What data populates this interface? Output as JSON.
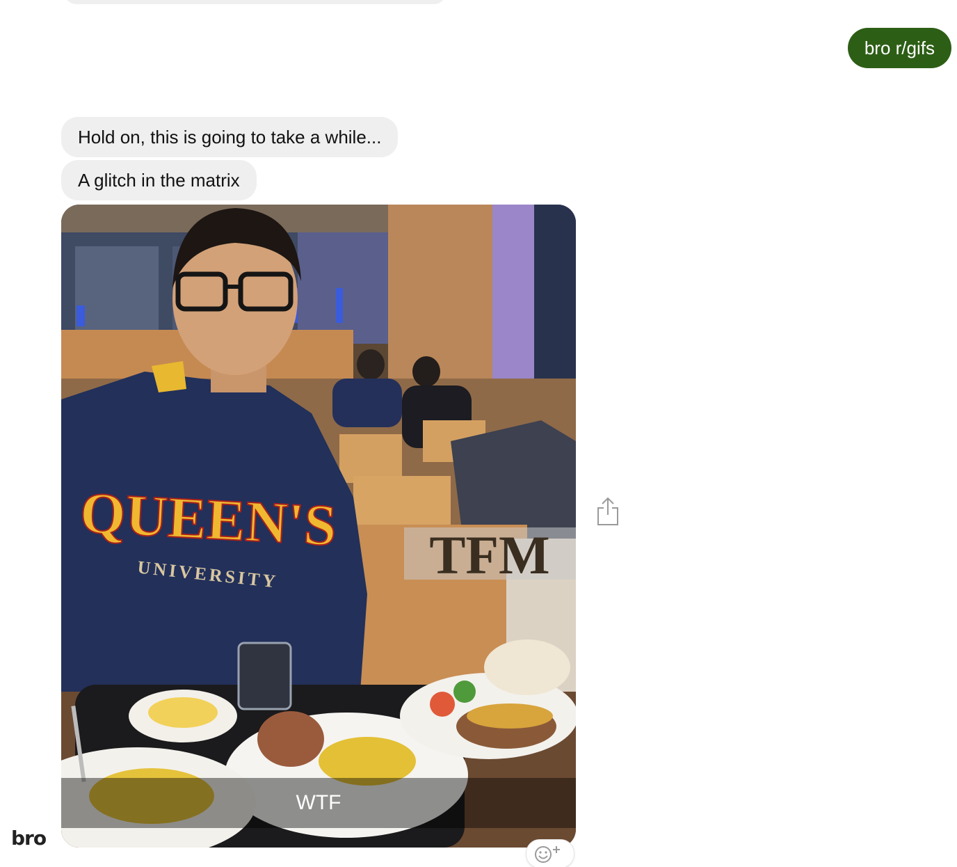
{
  "messages": {
    "outgoing": [
      {
        "text": "bro r/gifs"
      }
    ],
    "incoming": [
      {
        "text": "Hold on, this is going to take a while..."
      },
      {
        "text": "A glitch in the matrix"
      }
    ]
  },
  "media": {
    "caption": "WTF",
    "watermark": "TFM",
    "hoodie_text": "QUEEN'S",
    "hoodie_subtext": "UNIVERSITY"
  },
  "bot": {
    "logo_text": "bro"
  },
  "icons": {
    "share": "share-icon",
    "reaction": "add-reaction-icon"
  },
  "colors": {
    "outgoing_bubble": "#2d5e16",
    "incoming_bubble": "#efefef",
    "background": "#ffffff"
  }
}
